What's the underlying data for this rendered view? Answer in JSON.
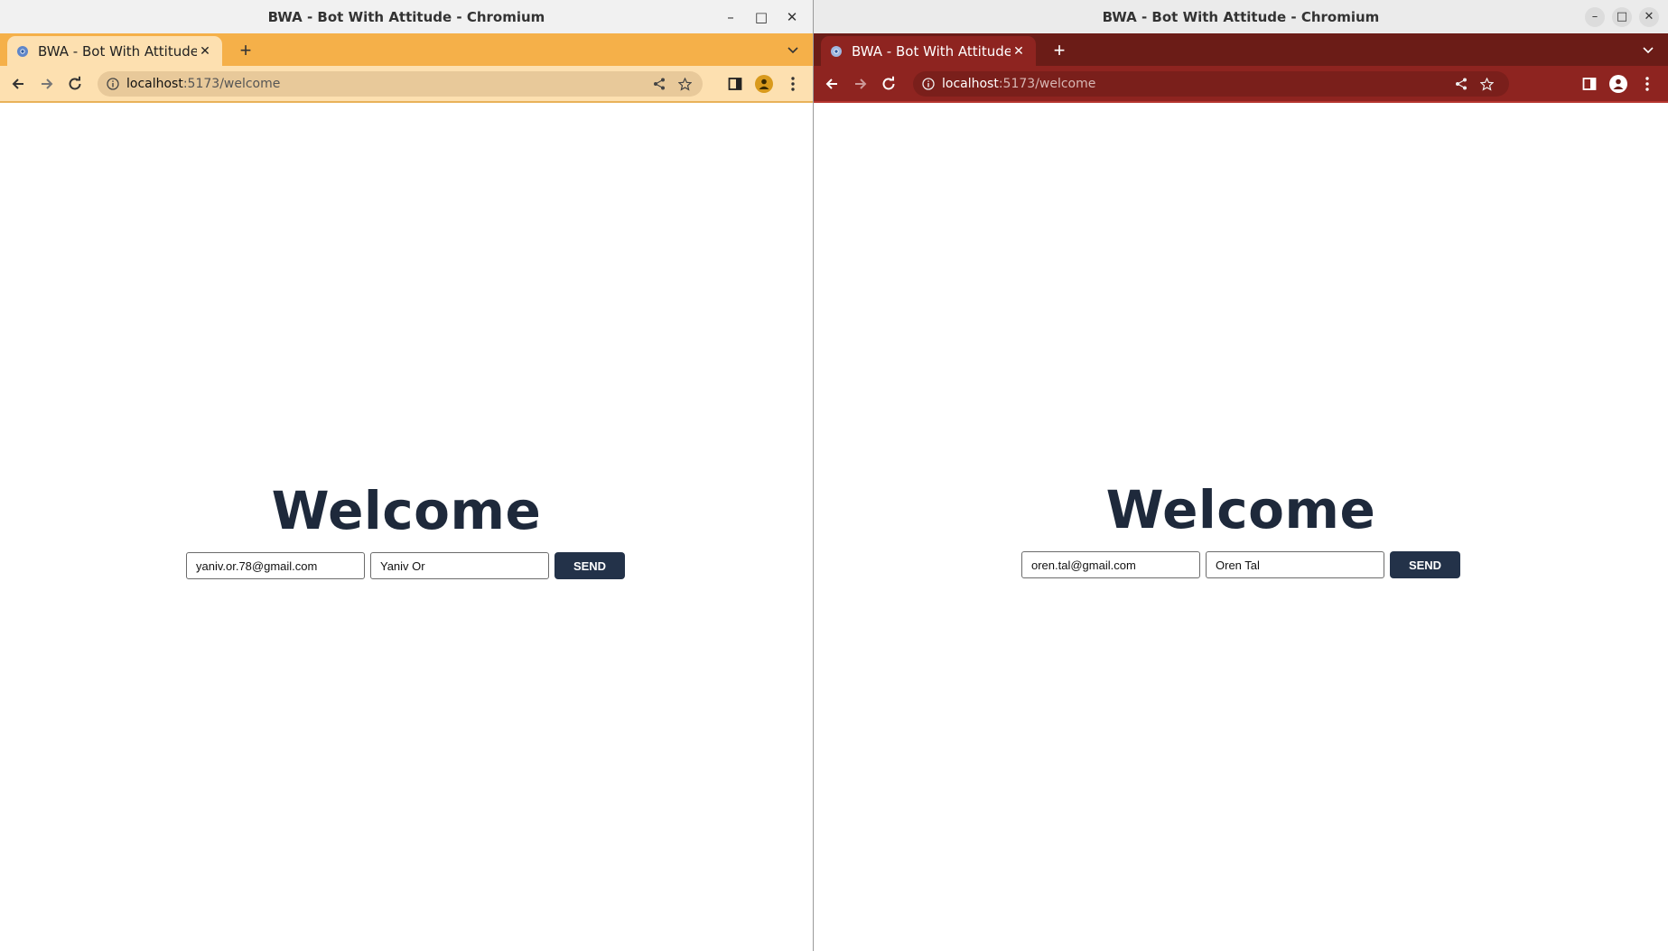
{
  "left_window": {
    "title": "BWA - Bot With Attitude - Chromium",
    "tab_title": "BWA - Bot With Attitude",
    "url_host": "localhost",
    "url_path": ":5173/welcome",
    "theme": {
      "tabstrip": "#f5b049",
      "toolbar": "#fde0b0",
      "omnibox": "#e8c99a",
      "accent": "#d99a1c"
    },
    "heading": "Welcome",
    "email_value": "yaniv.or.78@gmail.com",
    "name_value": "Yaniv Or",
    "send_label": "SEND"
  },
  "right_window": {
    "title": "BWA - Bot With Attitude - Chromium",
    "tab_title": "BWA - Bot With Attitude",
    "url_host": "localhost",
    "url_path": ":5173/welcome",
    "theme": {
      "tabstrip": "#6b1c17",
      "toolbar": "#8e2420",
      "omnibox": "#7a1f1b",
      "accent": "#ffffff"
    },
    "heading": "Welcome",
    "email_value": "oren.tal@gmail.com",
    "name_value": "Oren Tal",
    "send_label": "SEND"
  },
  "icons": {
    "minimize": "minimize-icon",
    "maximize": "maximize-icon",
    "close": "close-icon",
    "back": "back-arrow-icon",
    "forward": "forward-arrow-icon",
    "reload": "reload-icon",
    "info": "info-icon",
    "share": "share-icon",
    "bookmark": "star-icon",
    "side_panel": "side-panel-icon",
    "profile": "profile-icon",
    "menu": "kebab-menu-icon",
    "new_tab": "plus-icon",
    "tab_search": "chevron-down-icon",
    "favicon": "chromium-favicon-icon"
  }
}
